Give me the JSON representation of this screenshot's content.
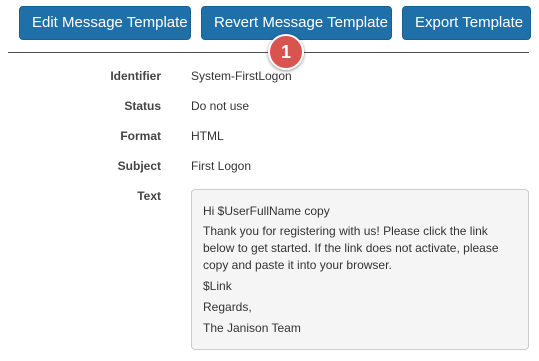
{
  "toolbar": {
    "edit_label": "Edit Message Template",
    "revert_label": "Revert Message Template",
    "export_label": "Export Template"
  },
  "callout_number": "1",
  "details": {
    "identifier_label": "Identifier",
    "identifier_value": "System-FirstLogon",
    "status_label": "Status",
    "status_value": "Do not use",
    "format_label": "Format",
    "format_value": "HTML",
    "subject_label": "Subject",
    "subject_value": "First Logon",
    "text_label": "Text"
  },
  "message_body": {
    "greeting": "Hi $UserFullName copy",
    "body": "Thank you for registering with us!  Please click the link below to get started. If the link does not activate, please copy and paste it into your browser.",
    "link": "$Link",
    "regards": "Regards,",
    "signature": "The Janison Team"
  },
  "colors": {
    "button": "#1f6fa9",
    "callout": "#d9534f",
    "text_box_bg": "#f5f5f5"
  }
}
